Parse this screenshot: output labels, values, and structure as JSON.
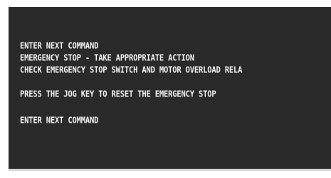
{
  "terminal": {
    "lines": [
      "ENTER NEXT COMMAND",
      "EMERGENCY STOP - TAKE APPROPRIATE ACTION",
      "CHECK EMERGENCY STOP SWITCH AND MOTOR OVERLOAD RELA",
      "PRESS THE JOG KEY TO RESET THE EMERGENCY STOP",
      "ENTER NEXT COMMAND"
    ],
    "colors": {
      "background": "#2a2a2a",
      "text": "#f2f2f2"
    }
  }
}
